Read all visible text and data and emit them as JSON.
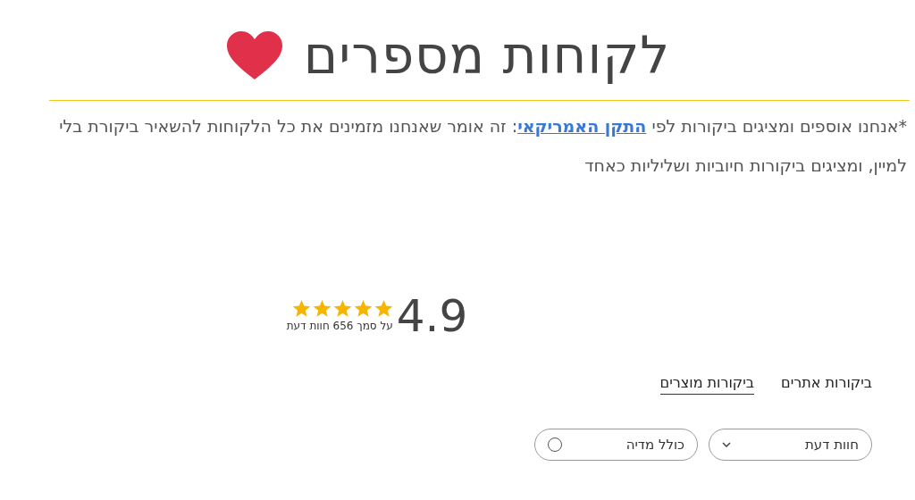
{
  "title": "לקוחות מספרים",
  "notice": {
    "before": "*אנחנו אוספים ומציגים ביקורות לפי ",
    "link": "התקן האמריקאי",
    "after": ": זה אומר שאנחנו מזמינים את כל הלקוחות להשאיר ביקורת בלי למיין, ומציגים ביקורות חיוביות ושליליות כאחד"
  },
  "rating": {
    "score": "4.9",
    "stars": 5,
    "count": "על סמך 656 חוות דעת"
  },
  "tabs": [
    {
      "label": "ביקורות אתרים",
      "selected": false
    },
    {
      "label": "ביקורות מוצרים",
      "selected": true
    }
  ],
  "filters": [
    {
      "kind": "dropdown",
      "label": "חוות דעת"
    },
    {
      "kind": "toggle",
      "label": "כולל מדיה",
      "on": false
    }
  ]
}
